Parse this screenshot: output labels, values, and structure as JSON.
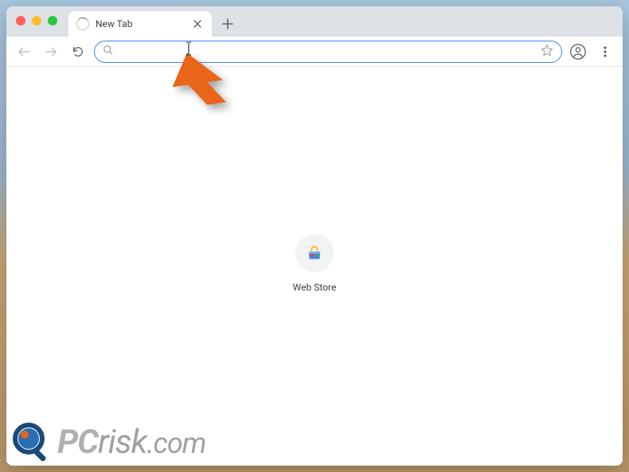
{
  "tab": {
    "title": "New Tab"
  },
  "toolbar": {
    "address_value": "",
    "address_placeholder": ""
  },
  "ntp": {
    "shortcuts": [
      {
        "label": "Web Store"
      }
    ]
  },
  "watermark": {
    "text_pc": "PC",
    "text_risk": "risk",
    "text_com": ".com"
  },
  "colors": {
    "arrow": "#e8651a"
  }
}
